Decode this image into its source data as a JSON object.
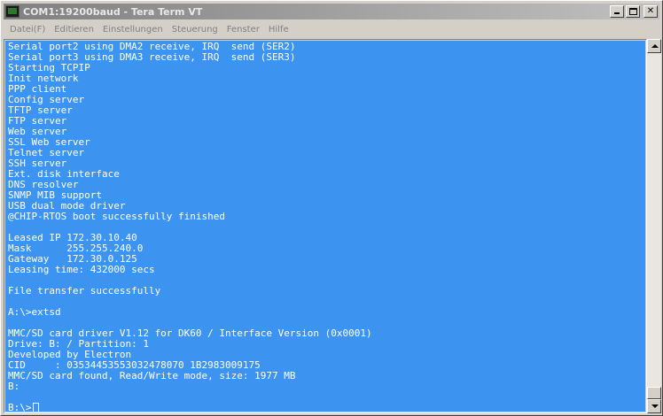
{
  "window": {
    "title": "COM1:19200baud - Tera Term VT",
    "minimize_label": "_",
    "maximize_label": "",
    "close_label": "✕"
  },
  "menu": [
    {
      "label": "Datei(F)"
    },
    {
      "label": "Editieren"
    },
    {
      "label": "Einstellungen"
    },
    {
      "label": "Steuerung"
    },
    {
      "label": "Fenster"
    },
    {
      "label": "Hilfe"
    }
  ],
  "terminal": {
    "lines": [
      "Serial port2 using DMA2 receive, IRQ  send (SER2)",
      "Serial port3 using DMA3 receive, IRQ  send (SER3)",
      "Starting TCPIP",
      "Init network",
      "PPP client",
      "Config server",
      "TFTP server",
      "FTP server",
      "Web server",
      "SSL Web server",
      "Telnet server",
      "SSH server",
      "Ext. disk interface",
      "DNS resolver",
      "SNMP MIB support",
      "USB dual mode driver",
      "@CHIP-RTOS boot successfully finished",
      "",
      "Leased IP 172.30.10.40",
      "Mask      255.255.240.0",
      "Gateway   172.30.0.125",
      "Leasing time: 432000 secs",
      "",
      "File transfer successfully",
      "",
      "A:\\>extsd",
      "",
      "MMC/SD card driver V1.12 for DK60 / Interface Version (0x0001)",
      "Drive: B: / Partition: 1",
      "Developed by Electron",
      "CID     : 03534453553032478070 1B2983009175",
      "MMC/SD card found, Read/Write mode, size: 1977 MB",
      "B:",
      "",
      "B:\\>"
    ]
  },
  "colors": {
    "terminal_background": "#3d94f0",
    "terminal_foreground": "#ffffff"
  }
}
